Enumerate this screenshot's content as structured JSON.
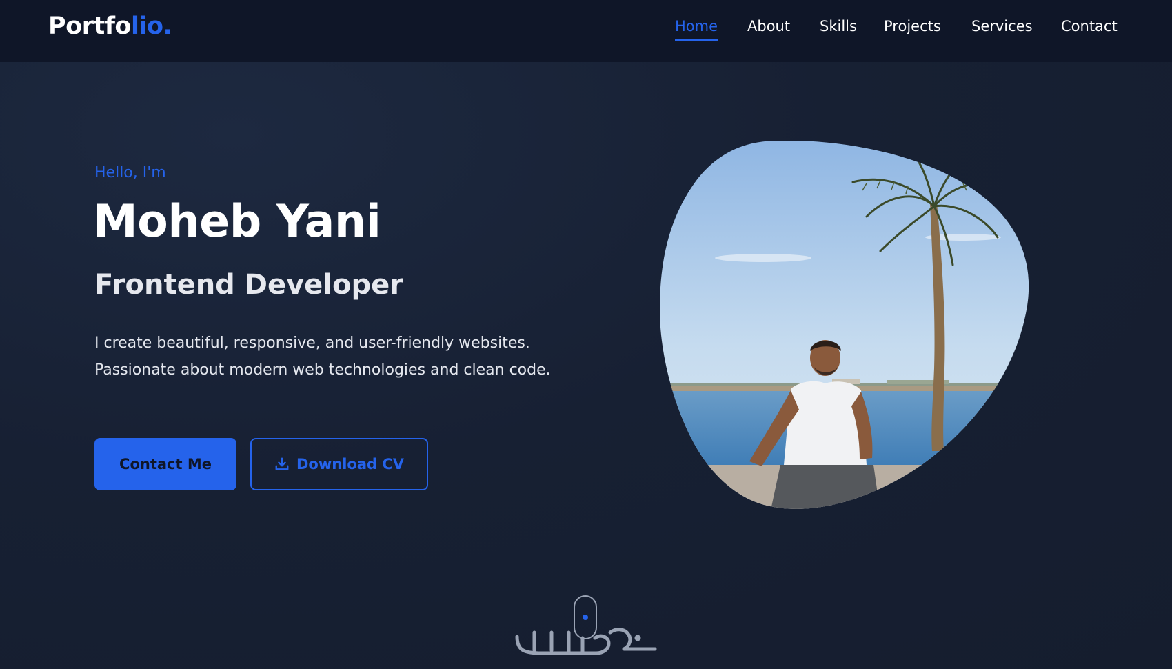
{
  "nav": {
    "logo_main": "Portfo",
    "logo_accent": "lio.",
    "links": [
      {
        "label": "Home",
        "active": true
      },
      {
        "label": "About",
        "active": false
      },
      {
        "label": "Skills",
        "active": false
      },
      {
        "label": "Projects",
        "active": false
      },
      {
        "label": "Services",
        "active": false
      },
      {
        "label": "Contact",
        "active": false
      }
    ]
  },
  "hero": {
    "greeting": "Hello, I'm",
    "name": "Moheb Yani",
    "role": "Frontend Developer",
    "description": "I create beautiful, responsive, and user-friendly websites. Passionate about modern web technologies and clean code.",
    "primary_button": "Contact Me",
    "secondary_button": "Download CV",
    "secondary_button_icon": "download-icon"
  },
  "photo": {
    "icon": "profile-photo"
  },
  "scroll_indicator": {
    "icon": "mouse-scroll-icon"
  },
  "watermark": {
    "icon": "khamsat-watermark"
  },
  "colors": {
    "accent": "#2563eb",
    "background": "#172033",
    "navbar": "#0f1628",
    "text": "#ffffff"
  }
}
